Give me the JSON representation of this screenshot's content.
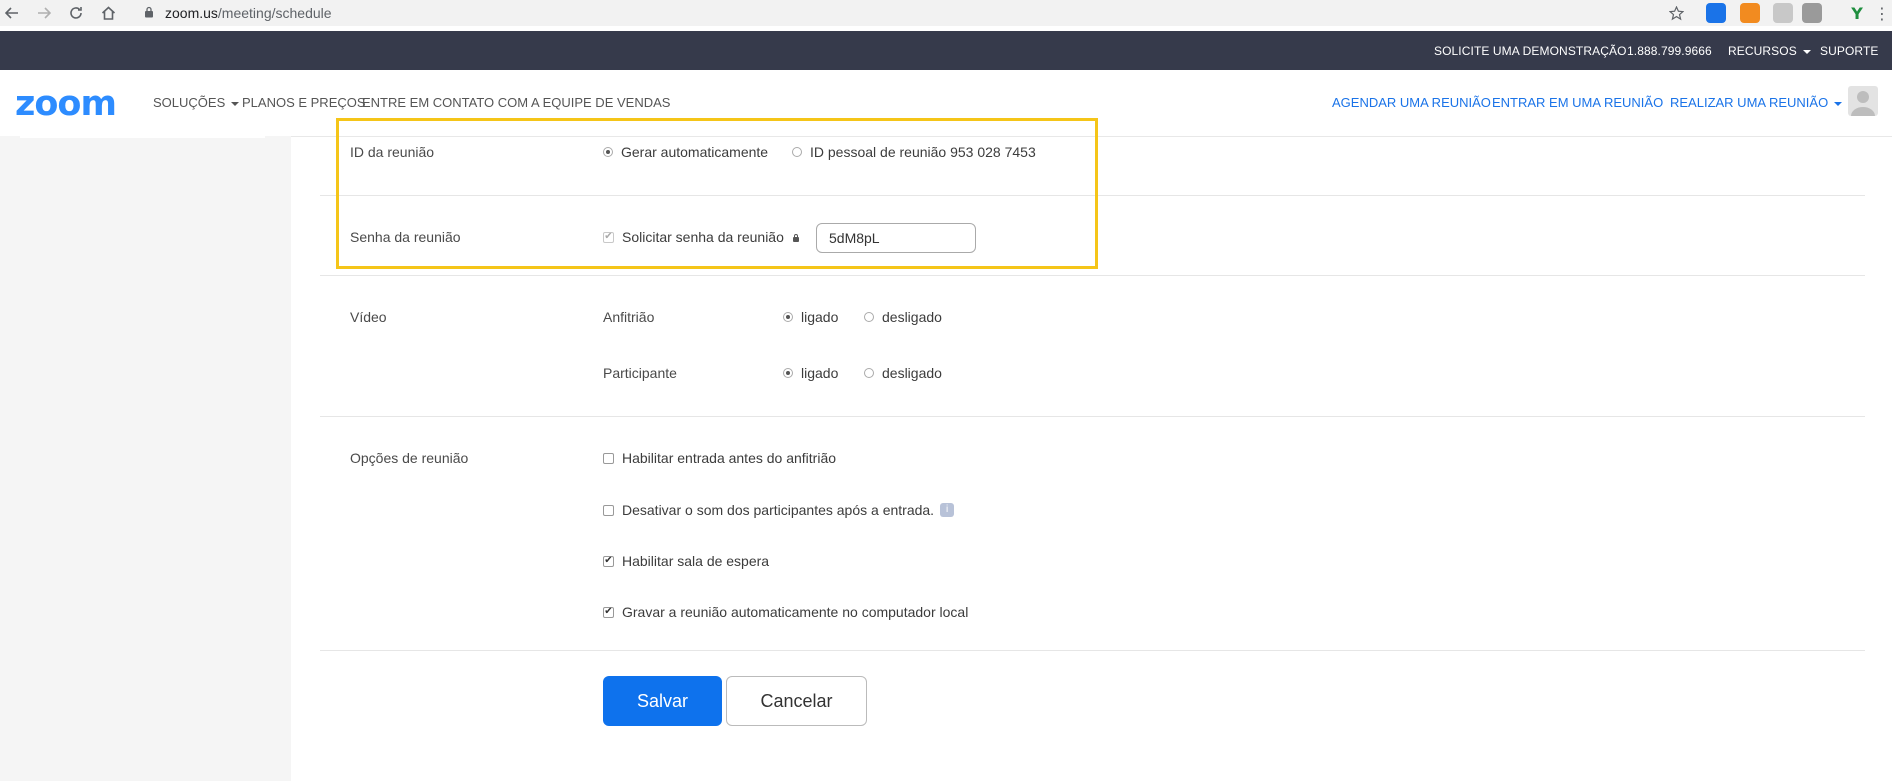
{
  "browser": {
    "url_host": "zoom.us",
    "url_path": "/meeting/schedule",
    "back_icon": "back-arrow-icon",
    "forward_icon": "forward-arrow-icon",
    "reload_icon": "reload-icon",
    "home_icon": "home-icon",
    "star_icon": "star-icon",
    "menu_icon": "kebab-menu-icon"
  },
  "top_bar": {
    "demo": "SOLICITE UMA DEMONSTRAÇÃO",
    "phone": "1.888.799.9666",
    "resources": "RECURSOS",
    "support": "SUPORTE"
  },
  "nav": {
    "logo": "zoom",
    "solutions": "SOLUÇÕES",
    "plans": "PLANOS E PREÇOS",
    "contact_sales": "ENTRE EM CONTATO COM A EQUIPE DE VENDAS",
    "schedule": "AGENDAR UMA REUNIÃO",
    "join": "ENTRAR EM UMA REUNIÃO",
    "host": "REALIZAR UMA REUNIÃO"
  },
  "form": {
    "meeting_id": {
      "label": "ID da reunião",
      "auto": "Gerar automaticamente",
      "personal": "ID pessoal de reunião 953 028 7453",
      "selected": "auto"
    },
    "password": {
      "label": "Senha da reunião",
      "require": "Solicitar senha da reunião",
      "value": "5dM8pL"
    },
    "video": {
      "label": "Vídeo",
      "host_label": "Anfitrião",
      "participant_label": "Participante",
      "on": "ligado",
      "off": "desligado"
    },
    "options": {
      "label": "Opções de reunião",
      "join_before_host": "Habilitar entrada antes do anfitrião",
      "mute_on_entry": "Desativar o som dos participantes após a entrada.",
      "waiting_room": "Habilitar sala de espera",
      "auto_record": "Gravar a reunião automaticamente no computador local"
    },
    "save": "Salvar",
    "cancel": "Cancelar"
  },
  "colors": {
    "accent": "#0e72ed",
    "highlight": "#f5c518",
    "top_bar": "#363a4b",
    "link": "#1a73e8"
  }
}
